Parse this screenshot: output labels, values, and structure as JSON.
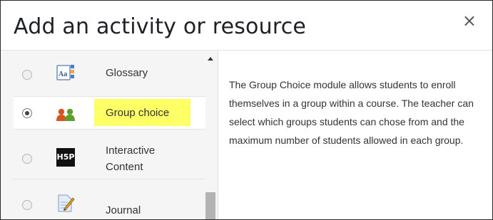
{
  "dialog": {
    "title": "Add an activity or resource",
    "close_icon": "close-icon",
    "close_glyph": "×"
  },
  "options": [
    {
      "label": "Glossary",
      "icon": "glossary-icon",
      "selected": false
    },
    {
      "label": "Group choice",
      "icon": "group-choice-icon",
      "selected": true
    },
    {
      "label_line1": "Interactive",
      "label_line2": "Content",
      "icon": "h5p-icon",
      "icon_text": "H5P",
      "selected": false
    },
    {
      "label": "Journal",
      "icon": "journal-icon",
      "selected": false
    }
  ],
  "description": "The Group Choice module allows students to enroll themselves in a group within a course. The teacher can select which groups students can chose from and the maximum number of students allowed in each group.",
  "colors": {
    "highlight": "#ffff66",
    "selected_row": "#ffffff",
    "list_background": "#f5f5f5",
    "scroll_thumb": "#b3b3b3"
  }
}
